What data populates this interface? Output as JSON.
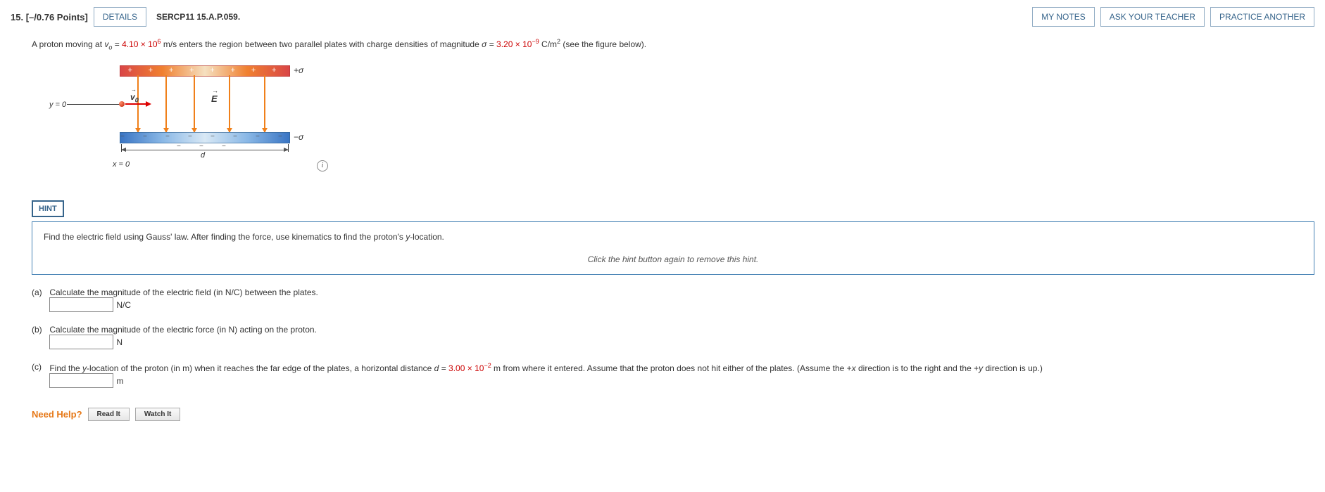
{
  "header": {
    "qnum": "15.",
    "points": "[–/0.76 Points]",
    "details": "DETAILS",
    "source": "SERCP11 15.A.P.059.",
    "my_notes": "MY NOTES",
    "ask": "ASK YOUR TEACHER",
    "practice": "PRACTICE ANOTHER"
  },
  "problem": {
    "pre1": "A proton moving at ",
    "v0": "v",
    "v0sub": "o",
    "eq": " = ",
    "v0val": "4.10 × 10",
    "v0exp": "6",
    "mid1": " m/s enters the region between two parallel plates with charge densities of magnitude ",
    "sigma": "σ",
    "sigmaval": "3.20 × 10",
    "sigmaexp": "−9",
    "end1": " C/m",
    "sq": "2",
    "end2": " (see the figure below)."
  },
  "figure": {
    "plus_row": "+ + + + + + + + + + +",
    "minus_row": "− − − − − − − − − − −",
    "sigma_plus": "+σ",
    "sigma_minus": "−σ",
    "E": "E",
    "v0": "v",
    "v0sub": "0",
    "y0": "y = 0",
    "d": "d",
    "x0": "x = 0",
    "info": "i"
  },
  "hint": {
    "btn": "HINT",
    "text_pre": "Find the electric field using Gauss' law. After finding the force, use kinematics to find the proton's ",
    "text_y": "y",
    "text_post": "-location.",
    "remove": "Click the hint button again to remove this hint."
  },
  "parts": {
    "a": {
      "label": "(a)",
      "text": "Calculate the magnitude of the electric field (in N/C) between the plates.",
      "unit": "N/C"
    },
    "b": {
      "label": "(b)",
      "text": "Calculate the magnitude of the electric force (in N) acting on the proton.",
      "unit": "N"
    },
    "c": {
      "label": "(c)",
      "pre": "Find the ",
      "y": "y",
      "mid1": "-location of the proton (in m) when it reaches the far edge of the plates, a horizontal distance ",
      "d": "d",
      "eq": " = ",
      "dval": "3.00 × 10",
      "dexp": "−2",
      "post": " m from where it entered. Assume that the proton does not hit either of the plates. (Assume the +",
      "x": "x",
      "post2": " direction is to the right and the +",
      "y2": "y",
      "post3": " direction is up.)",
      "unit": "m"
    }
  },
  "help": {
    "label": "Need Help?",
    "read": "Read It",
    "watch": "Watch It"
  }
}
